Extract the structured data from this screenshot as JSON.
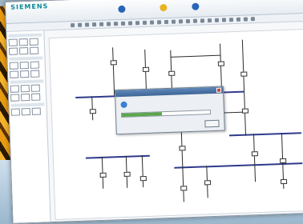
{
  "brand": {
    "line1": "",
    "line2": "",
    "logo": "SIEMENS"
  },
  "top_tabs": [
    {
      "icon": "blue-circle-icon",
      "color": "#2a64b8",
      "label": ""
    },
    {
      "icon": "yellow-circle-icon",
      "color": "#e8b320",
      "label": ""
    },
    {
      "icon": "blue-circle-icon",
      "color": "#2a64b8",
      "label": ""
    }
  ],
  "dialog": {
    "title": "",
    "message": "",
    "progress": 0.45,
    "button": ""
  },
  "colors": {
    "accent": "#0a8b98",
    "busbar": "#2e3a8c",
    "progress": "#5aa64a"
  }
}
